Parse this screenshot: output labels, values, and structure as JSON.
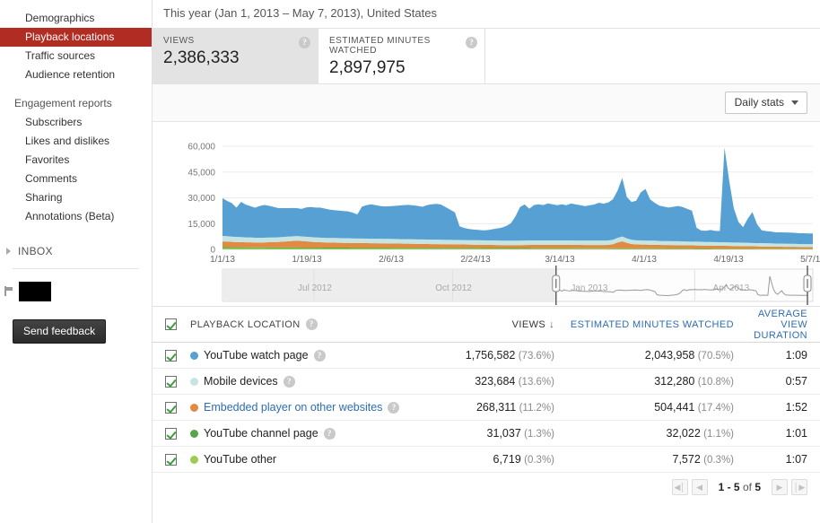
{
  "sidebar": {
    "items": [
      {
        "label": "Demographics",
        "active": false
      },
      {
        "label": "Playback locations",
        "active": true
      },
      {
        "label": "Traffic sources",
        "active": false
      },
      {
        "label": "Audience retention",
        "active": false
      }
    ],
    "section_label": "Engagement reports",
    "engagement_items": [
      {
        "label": "Subscribers"
      },
      {
        "label": "Likes and dislikes"
      },
      {
        "label": "Favorites"
      },
      {
        "label": "Comments"
      },
      {
        "label": "Sharing"
      },
      {
        "label": "Annotations (Beta)"
      }
    ],
    "inbox_label": "INBOX",
    "feedback_label": "Send feedback",
    "accent_color": "#b12c22"
  },
  "header": {
    "date_range": "This year (Jan 1, 2013 – May 7, 2013), United States"
  },
  "metrics": [
    {
      "label": "VIEWS",
      "value": "2,386,333",
      "selected": true
    },
    {
      "label": "ESTIMATED MINUTES WATCHED",
      "value": "2,897,975",
      "selected": false
    }
  ],
  "toolbar": {
    "stats_select": "Daily stats"
  },
  "chart_data": {
    "type": "area",
    "title": "",
    "xlabel": "",
    "ylabel": "",
    "ylim": [
      0,
      60000
    ],
    "yticks": [
      0,
      15000,
      30000,
      45000,
      60000
    ],
    "ytick_labels": [
      "0",
      "15,000",
      "30,000",
      "45,000",
      "60,000"
    ],
    "xtick_labels": [
      "1/1/13",
      "1/19/13",
      "2/6/13",
      "2/24/13",
      "3/14/13",
      "4/1/13",
      "4/19/13",
      "5/7/13"
    ],
    "grid": true,
    "stacked": true,
    "legend_position": "table",
    "scrubber_labels": [
      "Jul 2012",
      "Oct 2012",
      "Jan 2013",
      "Apr 2013"
    ],
    "series": [
      {
        "name": "YouTube other",
        "color": "#9ccd4f",
        "values": [
          700,
          700,
          680,
          660,
          650,
          640,
          640,
          630,
          620,
          620,
          610,
          600,
          600,
          590,
          590,
          580,
          580,
          570,
          570,
          560,
          560,
          560,
          550,
          550,
          550,
          540,
          540,
          540,
          530,
          530,
          530,
          520,
          520,
          520,
          510,
          510,
          510,
          500,
          500,
          500,
          500,
          490,
          490,
          490,
          480,
          480,
          480,
          470,
          470,
          470,
          460,
          460,
          460,
          450,
          450,
          450,
          440,
          440,
          440,
          430,
          430,
          430,
          420,
          420,
          420,
          410,
          410,
          410,
          400,
          400,
          400,
          400,
          390,
          390,
          390,
          380,
          380,
          380,
          370,
          370,
          370,
          360,
          360,
          360,
          350,
          350,
          350,
          340,
          340,
          340,
          330,
          330,
          330,
          320,
          320,
          320,
          310,
          310,
          310,
          300,
          300,
          300,
          290,
          290,
          290,
          280,
          280,
          280,
          270,
          270,
          270,
          260,
          260,
          260,
          250,
          250,
          250,
          240,
          240,
          240,
          230,
          230,
          230,
          220,
          220,
          220,
          210,
          210
        ]
      },
      {
        "name": "YouTube channel page",
        "color": "#57a54c",
        "values": [
          600,
          590,
          580,
          580,
          570,
          560,
          560,
          550,
          550,
          540,
          540,
          530,
          530,
          520,
          520,
          510,
          510,
          500,
          500,
          500,
          490,
          490,
          480,
          480,
          480,
          470,
          470,
          470,
          460,
          460,
          460,
          450,
          450,
          450,
          440,
          440,
          440,
          430,
          430,
          430,
          420,
          420,
          420,
          410,
          410,
          410,
          400,
          400,
          400,
          390,
          390,
          390,
          380,
          380,
          380,
          370,
          370,
          370,
          360,
          360,
          360,
          350,
          350,
          350,
          340,
          340,
          340,
          330,
          330,
          330,
          320,
          320,
          320,
          310,
          310,
          310,
          300,
          300,
          300,
          290,
          290,
          290,
          280,
          280,
          280,
          270,
          270,
          270,
          260,
          260,
          260,
          250,
          250,
          250,
          240,
          240,
          240,
          230,
          230,
          230,
          220,
          220,
          220,
          210,
          210,
          210,
          200,
          200,
          200,
          190,
          190,
          190,
          180,
          180,
          180,
          170,
          170,
          170,
          160,
          160,
          160,
          150,
          150,
          150,
          140,
          140,
          140,
          140
        ]
      },
      {
        "name": "Embedded player on other websites",
        "color": "#e08a42",
        "values": [
          3300,
          3300,
          3100,
          3000,
          3000,
          2900,
          2900,
          2800,
          2800,
          2900,
          3000,
          3100,
          3200,
          3400,
          3600,
          3800,
          4000,
          3800,
          3600,
          3400,
          3200,
          3100,
          3000,
          2950,
          2900,
          2850,
          2800,
          2800,
          2750,
          2700,
          2700,
          2650,
          2600,
          2600,
          2600,
          2550,
          2500,
          2500,
          2450,
          2400,
          2400,
          2350,
          2300,
          2300,
          2250,
          2200,
          2200,
          2150,
          2100,
          2100,
          2050,
          2000,
          2000,
          1950,
          1900,
          1900,
          1850,
          1800,
          1800,
          1750,
          1700,
          1700,
          1700,
          1700,
          1750,
          1800,
          1850,
          1900,
          1900,
          1900,
          1900,
          1900,
          1900,
          1900,
          1900,
          1900,
          1900,
          1900,
          1900,
          1900,
          1900,
          1900,
          1900,
          2000,
          2400,
          3400,
          4100,
          3200,
          2500,
          2300,
          2200,
          2200,
          2100,
          2100,
          2050,
          2000,
          2000,
          1950,
          1900,
          1900,
          1850,
          1800,
          1800,
          1750,
          1700,
          1700,
          1650,
          1600,
          1600,
          1550,
          1500,
          1500,
          1450,
          1400,
          1400,
          1350,
          1300,
          1300,
          1250,
          1200,
          1200,
          1150,
          1100,
          1100,
          1050,
          1000,
          1000,
          1000
        ]
      },
      {
        "name": "Mobile devices",
        "color": "#c6e5e2",
        "values": [
          3200,
          3100,
          3050,
          3000,
          2950,
          2900,
          2850,
          2800,
          2800,
          2750,
          2750,
          2700,
          2700,
          2700,
          2700,
          2700,
          2700,
          2700,
          2700,
          2700,
          2700,
          2700,
          2700,
          2700,
          2700,
          2700,
          2700,
          2700,
          2650,
          2650,
          2650,
          2650,
          2650,
          2650,
          2650,
          2650,
          2650,
          2650,
          2600,
          2600,
          2600,
          2600,
          2600,
          2600,
          2600,
          2600,
          2600,
          2600,
          2600,
          2600,
          2600,
          2600,
          2600,
          2600,
          2600,
          2600,
          2600,
          2600,
          2600,
          2600,
          2600,
          2600,
          2600,
          2600,
          2600,
          2600,
          2600,
          2600,
          2600,
          2600,
          2600,
          2600,
          2600,
          2600,
          2600,
          2600,
          2600,
          2600,
          2600,
          2600,
          2600,
          2600,
          2600,
          2600,
          2600,
          2700,
          2800,
          2600,
          2500,
          2400,
          2400,
          2400,
          2400,
          2400,
          2300,
          2300,
          2300,
          2300,
          2300,
          2200,
          2200,
          2200,
          2200,
          2200,
          2100,
          2100,
          2100,
          2100,
          2100,
          2000,
          2000,
          2000,
          2000,
          2000,
          1900,
          1900,
          1900,
          1900,
          1900,
          1800,
          1800,
          1800,
          1800,
          1800,
          1700,
          1700,
          1700,
          1700
        ]
      },
      {
        "name": "YouTube watch page",
        "color": "#56a0d3",
        "values": [
          22000,
          20500,
          19500,
          17000,
          20500,
          19000,
          18200,
          17500,
          18500,
          19000,
          18500,
          17800,
          17000,
          16800,
          16600,
          16500,
          16200,
          16000,
          17000,
          17500,
          17400,
          17500,
          17000,
          16500,
          16200,
          16000,
          15800,
          15600,
          15000,
          14000,
          18500,
          19500,
          20000,
          19500,
          19000,
          18800,
          19000,
          19200,
          19500,
          19800,
          20000,
          19800,
          19500,
          19000,
          20000,
          20500,
          20800,
          20500,
          19000,
          17500,
          16000,
          8000,
          7000,
          6500,
          6200,
          6000,
          5800,
          6000,
          6500,
          7000,
          7500,
          8500,
          10000,
          14000,
          19500,
          21000,
          18500,
          20500,
          21000,
          20500,
          21500,
          21000,
          20500,
          21000,
          20500,
          21500,
          21000,
          20500,
          20000,
          20500,
          21000,
          22000,
          21500,
          22000,
          23500,
          27500,
          34000,
          24000,
          22000,
          23000,
          28000,
          30000,
          24000,
          22000,
          20500,
          20000,
          19500,
          20000,
          20500,
          20000,
          19000,
          18000,
          8000,
          6500,
          6500,
          7000,
          6500,
          6500,
          55000,
          36000,
          20000,
          12000,
          9000,
          14000,
          18000,
          11000,
          7500,
          7000,
          6800,
          6500,
          6500,
          6500,
          6500,
          6400,
          6300,
          6300,
          6200,
          6200
        ]
      }
    ]
  },
  "table": {
    "header": {
      "name": "PLAYBACK LOCATION",
      "views": "VIEWS",
      "views_sort_arrow": "↓",
      "minutes": "ESTIMATED MINUTES WATCHED",
      "avg_duration": "AVERAGE VIEW DURATION"
    },
    "rows": [
      {
        "color": "#56a0d3",
        "label": "YouTube watch page",
        "link": false,
        "help": true,
        "views": "1,756,582",
        "views_pct": "(73.6%)",
        "minutes": "2,043,958",
        "minutes_pct": "(70.5%)",
        "duration": "1:09"
      },
      {
        "color": "#c6e5e2",
        "label": "Mobile devices",
        "link": false,
        "help": true,
        "views": "323,684",
        "views_pct": "(13.6%)",
        "minutes": "312,280",
        "minutes_pct": "(10.8%)",
        "duration": "0:57"
      },
      {
        "color": "#e08a42",
        "label": "Embedded player on other websites",
        "link": true,
        "help": true,
        "views": "268,311",
        "views_pct": "(11.2%)",
        "minutes": "504,441",
        "minutes_pct": "(17.4%)",
        "duration": "1:52"
      },
      {
        "color": "#57a54c",
        "label": "YouTube channel page",
        "link": false,
        "help": true,
        "views": "31,037",
        "views_pct": "(1.3%)",
        "minutes": "32,022",
        "minutes_pct": "(1.1%)",
        "duration": "1:01"
      },
      {
        "color": "#9ccd4f",
        "label": "YouTube other",
        "link": false,
        "help": false,
        "views": "6,719",
        "views_pct": "(0.3%)",
        "minutes": "7,572",
        "minutes_pct": "(0.3%)",
        "duration": "1:07"
      }
    ],
    "pager": {
      "first": "◀│",
      "prev": "◀",
      "info_range": "1 - 5",
      "info_of": "of",
      "info_total": "5",
      "next": "▶",
      "last": "│▶"
    }
  }
}
